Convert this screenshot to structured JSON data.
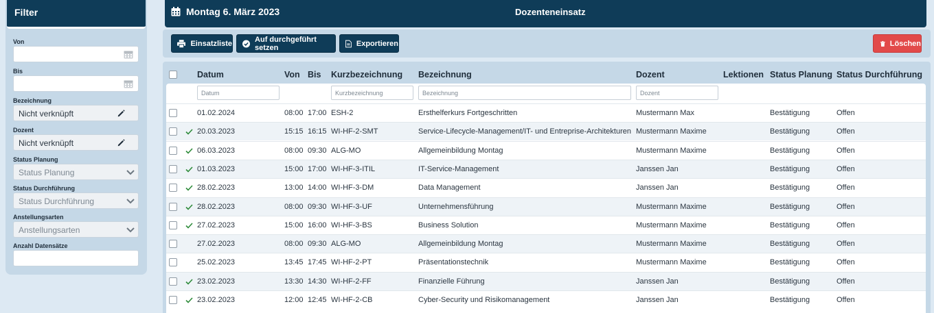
{
  "sidebar": {
    "title": "Filter",
    "fields": {
      "von": {
        "label": "Von",
        "value": ""
      },
      "bis": {
        "label": "Bis",
        "value": ""
      },
      "bezeichnung": {
        "label": "Bezeichnung",
        "value": "Nicht verknüpft"
      },
      "dozent": {
        "label": "Dozent",
        "value": "Nicht verknüpft"
      },
      "status_planung": {
        "label": "Status Planung",
        "value": "Status Planung"
      },
      "status_durchfuehrung": {
        "label": "Status Durchführung",
        "value": "Status Durchführung"
      },
      "anstellungsarten": {
        "label": "Anstellungsarten",
        "value": "Anstellungsarten"
      },
      "anzahl": {
        "label": "Anzahl Datensätze",
        "value": ""
      }
    }
  },
  "header": {
    "date": "Montag 6. März 2023",
    "title": "Dozenteneinsatz",
    "icon": "calendar-icon"
  },
  "toolbar": {
    "einsatzliste": "Einsatzliste",
    "durchgefuehrt": "Auf durchgeführt setzen",
    "exportieren": "Exportieren",
    "loeschen": "Löschen"
  },
  "table": {
    "columns": {
      "datum": "Datum",
      "von": "Von",
      "bis": "Bis",
      "kurz": "Kurzbezeichnung",
      "bez": "Bezeichnung",
      "dozent": "Dozent",
      "lektionen": "Lektionen",
      "status_planung": "Status Planung",
      "status_durchf": "Status Durchführung"
    },
    "filters": {
      "datum": "Datum",
      "kurz": "Kurzbezeichnung",
      "bez": "Bezeichnung",
      "dozent": "Dozent"
    },
    "rows": [
      {
        "done": false,
        "datum": "01.02.2024",
        "von": "08:00",
        "bis": "17:00",
        "kurz": "ESH-2",
        "bez": "Ersthelferkurs Fortgeschritten",
        "dozent": "Mustermann Max",
        "status_planung": "Bestätigung",
        "status_durchf": "Offen"
      },
      {
        "done": true,
        "datum": "20.03.2023",
        "von": "15:15",
        "bis": "16:15",
        "kurz": "WI-HF-2-SMT",
        "bez": "Service-Lifecycle-Management/IT- und Entreprise-Architekturen",
        "dozent": "Mustermann Maxime",
        "status_planung": "Bestätigung",
        "status_durchf": "Offen"
      },
      {
        "done": true,
        "datum": "06.03.2023",
        "von": "08:00",
        "bis": "09:30",
        "kurz": "ALG-MO",
        "bez": "Allgemeinbildung Montag",
        "dozent": "Mustermann Maxime",
        "status_planung": "Bestätigung",
        "status_durchf": "Offen"
      },
      {
        "done": true,
        "datum": "01.03.2023",
        "von": "15:00",
        "bis": "17:00",
        "kurz": "WI-HF-3-ITIL",
        "bez": "IT-Service-Management",
        "dozent": "Janssen Jan",
        "status_planung": "Bestätigung",
        "status_durchf": "Offen"
      },
      {
        "done": true,
        "datum": "28.02.2023",
        "von": "13:00",
        "bis": "14:00",
        "kurz": "WI-HF-3-DM",
        "bez": "Data Management",
        "dozent": "Janssen Jan",
        "status_planung": "Bestätigung",
        "status_durchf": "Offen"
      },
      {
        "done": true,
        "datum": "28.02.2023",
        "von": "08:00",
        "bis": "09:30",
        "kurz": "WI-HF-3-UF",
        "bez": "Unternehmensführung",
        "dozent": "Mustermann Maxime",
        "status_planung": "Bestätigung",
        "status_durchf": "Offen"
      },
      {
        "done": true,
        "datum": "27.02.2023",
        "von": "15:00",
        "bis": "16:00",
        "kurz": "WI-HF-3-BS",
        "bez": "Business Solution",
        "dozent": "Mustermann Maxime",
        "status_planung": "Bestätigung",
        "status_durchf": "Offen"
      },
      {
        "done": false,
        "datum": "27.02.2023",
        "von": "08:00",
        "bis": "09:30",
        "kurz": "ALG-MO",
        "bez": "Allgemeinbildung Montag",
        "dozent": "Mustermann Maxime",
        "status_planung": "Bestätigung",
        "status_durchf": "Offen"
      },
      {
        "done": false,
        "datum": "25.02.2023",
        "von": "13:45",
        "bis": "17:45",
        "kurz": "WI-HF-2-PT",
        "bez": "Präsentationstechnik",
        "dozent": "Mustermann Maxime",
        "status_planung": "Bestätigung",
        "status_durchf": "Offen"
      },
      {
        "done": true,
        "datum": "23.02.2023",
        "von": "13:30",
        "bis": "14:30",
        "kurz": "WI-HF-2-FF",
        "bez": "Finanzielle Führung",
        "dozent": "Janssen Jan",
        "status_planung": "Bestätigung",
        "status_durchf": "Offen"
      },
      {
        "done": true,
        "datum": "23.02.2023",
        "von": "12:00",
        "bis": "12:45",
        "kurz": "WI-HF-2-CB",
        "bez": "Cyber-Security und Risikomanagement",
        "dozent": "Janssen Jan",
        "status_planung": "Bestätigung",
        "status_durchf": "Offen"
      }
    ]
  }
}
